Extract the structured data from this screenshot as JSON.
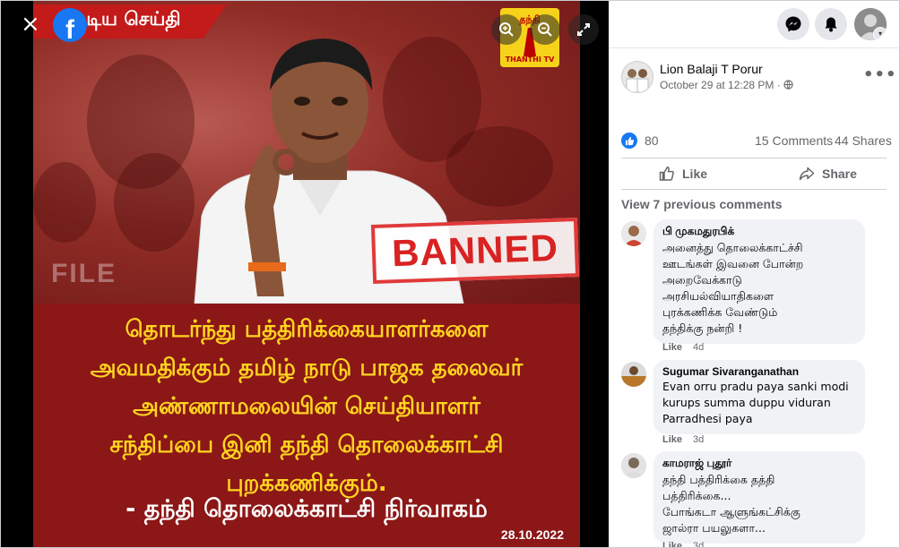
{
  "viewer": {
    "close_icon": "×",
    "logo_letter": "f",
    "poster": {
      "corner_tag": "முடிய செய்தி",
      "channel_logo_top": "தந்தி",
      "channel_logo_bottom": "THANTHI TV",
      "file_label": "FILE",
      "banned_stamp": "BANNED",
      "headline_lines": [
        "தொடர்ந்து பத்திரிக்கையாளர்களை",
        "அவமதிக்கும் தமிழ் நாடு பாஜக தலைவர்",
        "அண்ணாமலையின் செய்தியாளர்",
        "சந்திப்பை  இனி தந்தி தொலைக்காட்சி",
        "புறக்கணிக்கும்."
      ],
      "signoff": "- தந்தி தொலைக்காட்சி நிர்வாகம்",
      "date": "28.10.2022"
    }
  },
  "post": {
    "author": "Lion Balaji T Porur",
    "timestamp": "October 29 at 12:28 PM · ",
    "reactions": "80",
    "comments": "15 Comments",
    "shares": "44 Shares",
    "like_label": "Like",
    "share_label": "Share",
    "view_previous": "View 7 previous comments",
    "more_icon": "•••"
  },
  "comments": [
    {
      "name": "பி முகமதுரபிக்",
      "lines": [
        "அனைத்து தொலைக்காட்ச்சி",
        "ஊடங்கள் இவனை போன்ற",
        "அறைவேக்காடு",
        "அரசியல்வியாதிகளை",
        "புரக்கணிக்க வேண்டும்",
        "தந்திக்கு நன்றி !"
      ],
      "like": "Like",
      "time": "4d"
    },
    {
      "name": "Sugumar Sivaranganathan",
      "lines": [
        "Evan orru pradu paya sanki modi",
        "kurups summa duppu viduran",
        "Parradhesi paya"
      ],
      "like": "Like",
      "time": "3d"
    },
    {
      "name": "காமராஜ் புதூர்",
      "lines": [
        "தந்தி பத்திரிக்கை தத்தி",
        "பத்திரிக்கை...",
        "போங்கடா ஆளுங்கட்சிக்கு",
        "ஜால்ரா பயலுகளா..."
      ],
      "like": "Like",
      "time": "3d"
    }
  ],
  "colors": {
    "accent": "#1877f2",
    "poster_red": "#8c1717",
    "headline_yellow": "#ffd51f"
  }
}
